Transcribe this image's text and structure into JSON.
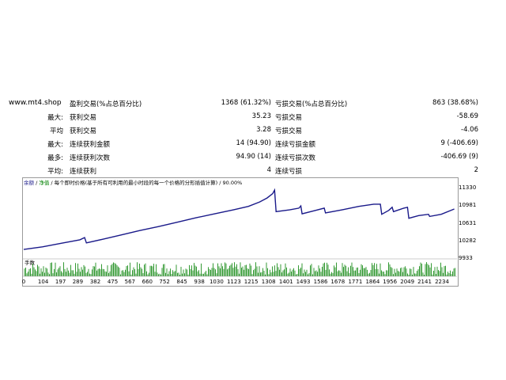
{
  "site": "www.mt4.shop",
  "stats": [
    {
      "label": "",
      "c1": "盈利交易(%占总百分比)",
      "v1": "1368 (61.32%)",
      "c2": "亏损交易(%占总百分比)",
      "v2": "863 (38.68%)"
    },
    {
      "label": "最大:",
      "c1": "获利交易",
      "v1": "35.23",
      "c2": "亏损交易",
      "v2": "-58.69"
    },
    {
      "label": "平均",
      "c1": "获利交易",
      "v1": "3.28",
      "c2": "亏损交易",
      "v2": "-4.06"
    },
    {
      "label": "最大:",
      "c1": "连续获利金额",
      "v1": "14 (94.90)",
      "c2": "连续亏损金额",
      "v2": "9 (-406.69)"
    },
    {
      "label": "最多:",
      "c1": "连续获利次数",
      "v1": "94.90 (14)",
      "c2": "连续亏损次数",
      "v2": "-406.69 (9)"
    },
    {
      "label": "平均:",
      "c1": "连续获利",
      "v1": "4",
      "c2": "连续亏损",
      "v2": "2"
    }
  ],
  "chart_header": {
    "legend1": "余额",
    "sep": " / ",
    "legend2": "净值",
    "desc": " / 每个即时价格(基于所有可利用的最小时段的每一个价格的分形插值计算) / 90.00%"
  },
  "volume_label": "手数",
  "colors": {
    "line": "#1a1a8a",
    "volume": "#008000",
    "frame": "#9a9a9a"
  },
  "chart_data": {
    "type": "line",
    "y_ticks": [
      "11330",
      "10981",
      "10631",
      "10282",
      "9933"
    ],
    "y_tick_values": [
      11330,
      10981,
      10631,
      10282,
      9933
    ],
    "x_ticks": [
      "0",
      "104",
      "197",
      "289",
      "382",
      "475",
      "567",
      "660",
      "752",
      "845",
      "938",
      "1030",
      "1123",
      "1215",
      "1308",
      "1401",
      "1493",
      "1586",
      "1678",
      "1771",
      "1864",
      "1956",
      "2049",
      "2141",
      "2234"
    ],
    "x_tick_values": [
      0,
      104,
      197,
      289,
      382,
      475,
      567,
      660,
      752,
      845,
      938,
      1030,
      1123,
      1215,
      1308,
      1401,
      1493,
      1586,
      1678,
      1771,
      1864,
      1956,
      2049,
      2141,
      2234
    ],
    "x_max": 2310,
    "ylim": [
      9800,
      11420
    ],
    "balance": [
      [
        0,
        9960
      ],
      [
        100,
        10020
      ],
      [
        200,
        10100
      ],
      [
        300,
        10180
      ],
      [
        325,
        10230
      ],
      [
        335,
        10110
      ],
      [
        420,
        10190
      ],
      [
        520,
        10290
      ],
      [
        620,
        10390
      ],
      [
        720,
        10480
      ],
      [
        820,
        10580
      ],
      [
        920,
        10680
      ],
      [
        1020,
        10770
      ],
      [
        1120,
        10860
      ],
      [
        1200,
        10940
      ],
      [
        1260,
        11040
      ],
      [
        1300,
        11130
      ],
      [
        1330,
        11230
      ],
      [
        1340,
        11310
      ],
      [
        1348,
        10820
      ],
      [
        1420,
        10860
      ],
      [
        1470,
        10900
      ],
      [
        1480,
        10950
      ],
      [
        1487,
        10770
      ],
      [
        1560,
        10850
      ],
      [
        1605,
        10900
      ],
      [
        1612,
        10790
      ],
      [
        1700,
        10860
      ],
      [
        1790,
        10940
      ],
      [
        1870,
        10990
      ],
      [
        1905,
        10990
      ],
      [
        1912,
        10760
      ],
      [
        1950,
        10850
      ],
      [
        1968,
        10920
      ],
      [
        1975,
        10820
      ],
      [
        2030,
        10900
      ],
      [
        2050,
        10920
      ],
      [
        2057,
        10670
      ],
      [
        2110,
        10730
      ],
      [
        2162,
        10760
      ],
      [
        2168,
        10710
      ],
      [
        2230,
        10760
      ],
      [
        2300,
        10880
      ]
    ]
  }
}
